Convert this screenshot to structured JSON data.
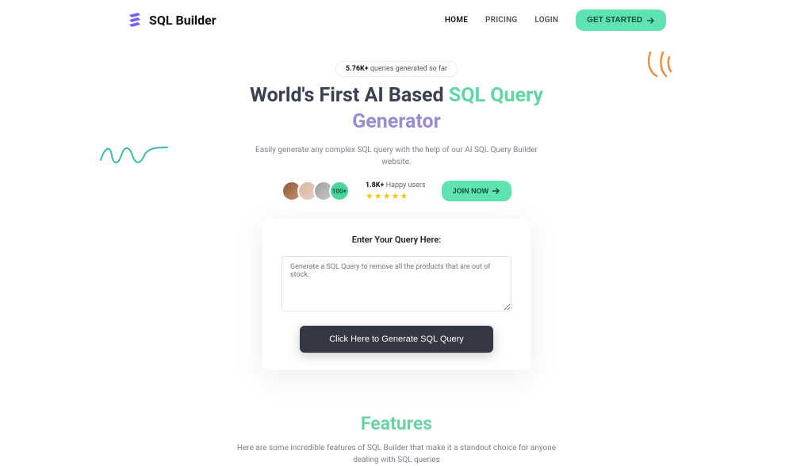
{
  "header": {
    "brand": "SQL Builder",
    "nav": {
      "home": "HOME",
      "pricing": "PRICING",
      "login": "LOGIN",
      "get_started": "GET STARTED"
    }
  },
  "hero": {
    "badge_bold": "5.76K+",
    "badge_rest": " queries generated so far",
    "title_a": "World's First AI Based ",
    "title_b_teal": "SQL Query",
    "title_c_violet": "Generator",
    "subhead": "Easily generate any complex SQL query with the help of our AI SQL Query Builder website.",
    "avatar_more": "100+",
    "happy_bold": "1.8K+",
    "happy_rest": " Happy users",
    "join_now": "JOIN NOW"
  },
  "query": {
    "title": "Enter Your Query Here:",
    "placeholder": "Generate a SQL Query to remove all the products that are out of stock.",
    "button": "Click Here to Generate SQL Query"
  },
  "features": {
    "title": "Features",
    "sub": "Here are some incredible features of SQL Builder that make it a standout choice for anyone dealing with SQL queries"
  }
}
